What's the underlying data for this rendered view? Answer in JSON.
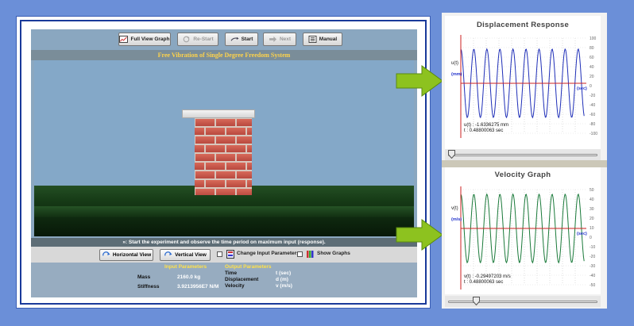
{
  "toolbar": {
    "full_view": "Full View Graph",
    "restart": "Re-Start",
    "start": "Start",
    "next": "Next",
    "manual": "Manual"
  },
  "sim_title": "Free Vibration of Single Degree Freedom System",
  "instruction": "»: Start the experiment and observe the time period on maximum input (response).",
  "controls": {
    "horizontal": "Horizontal View",
    "vertical": "Vertical View",
    "change_params": "Change Input Parameters",
    "show_graphs": "Show Graphs"
  },
  "input_params": {
    "heading": "Input Parameters",
    "mass_label": "Mass",
    "mass_value": "2160.0 kg",
    "stiffness_label": "Stiffness",
    "stiffness_value": "3.9213956E7 N/M"
  },
  "output_params": {
    "heading": "Output Parameters",
    "rows": [
      {
        "label": "Time",
        "unit": "t (sec)"
      },
      {
        "label": "Displacement",
        "unit": "d (m)"
      },
      {
        "label": "Velocity",
        "unit": "v (m/s)"
      }
    ]
  },
  "displacement_graph": {
    "title": "Displacement Response",
    "ylabel": "u(t)",
    "yunit": "(mm)",
    "xunit": "(sec)",
    "color": "#1f2fb8",
    "yticks": [
      "100",
      "80",
      "60",
      "40",
      "20",
      "0",
      "-20",
      "-40",
      "-60",
      "-80",
      "-100"
    ],
    "readout_value": "u(t) : -1.6336275 mm",
    "readout_time": "t : 0.48800063 sec",
    "slider_fraction": 0.0
  },
  "velocity_graph": {
    "title": "Velocity Graph",
    "ylabel": "v(t)",
    "yunit": "(m/s)",
    "xunit": "(sec)",
    "color": "#1a7a3a",
    "yticks": [
      "50",
      "40",
      "30",
      "20",
      "10",
      "0",
      "-10",
      "-20",
      "-30",
      "-40",
      "-50"
    ],
    "readout_value": "v(t) : -0.29497203 m/s",
    "readout_time": "t : 0.48800063 sec",
    "slider_fraction": 0.17
  },
  "colors": {
    "background": "#6b8fd8",
    "arrow": "#8dc21f",
    "axis_red": "#cc2222",
    "title_yellow": "#ffd34a"
  }
}
